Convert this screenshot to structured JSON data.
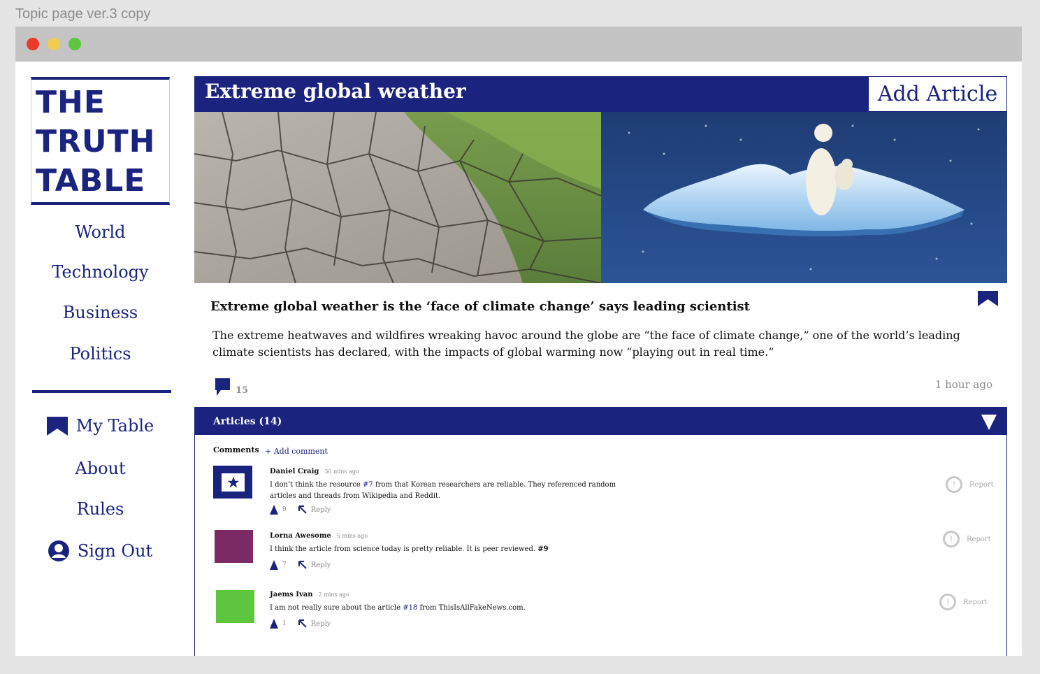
{
  "artboard_title": "Topic page ver.3 copy",
  "logo": {
    "line1": "THE",
    "line2": "TRUTH",
    "line3": "TABLE"
  },
  "nav": {
    "world": "World",
    "technology": "Technology",
    "business": "Business",
    "politics": "Politics",
    "my_table": "My Table",
    "about": "About",
    "rules": "Rules",
    "sign_out": "Sign Out"
  },
  "topic": {
    "title": "Extreme global weather",
    "add_article_label": "Add Article"
  },
  "article": {
    "headline": "Extreme global weather is the ‘face of climate change’ says leading scientist",
    "summary": "The extreme heatwaves and wildfires wreaking havoc around the globe are “the face of climate change,” one of the world’s leading climate scientists has declared, with the impacts of global warming now “playing out in real time.”",
    "comment_count": "15",
    "time_ago": "1 hour ago"
  },
  "articles_panel": {
    "label": "Articles (14)",
    "comments_label": "Comments",
    "add_comment_label": "+ Add comment",
    "reply_label": "Reply",
    "report_label": "Report"
  },
  "comments": [
    {
      "name": "Daniel Craig",
      "time": "30 mins ago",
      "text_before": "I don’t think the resource ",
      "ref": "#7",
      "text_after": " from that Korean researchers are reliable. They referenced random articles and threads from Wikipedia and Reddit.",
      "votes": "9",
      "avatar_color": "#1a237e"
    },
    {
      "name": "Lorna Awesome",
      "time": "5 mins ago",
      "text_before": "I think the article from science today is pretty reliable. It is peer reviewed. ",
      "ref": "#9",
      "text_after": "",
      "votes": "7",
      "avatar_color": "#7b2a63"
    },
    {
      "name": "Jaems Ivan",
      "time": "2 mins ago",
      "text_before": "I am not really sure about the article ",
      "ref": "#18",
      "text_after": " from ThisIsAllFakeNews.com.",
      "votes": "1",
      "avatar_color": "#5ec53e"
    }
  ],
  "colors": {
    "brand": "#1a237e",
    "muted": "#8a8a8a"
  },
  "icons": [
    "bookmark-icon",
    "user-circle-icon",
    "comment-icon",
    "chevron-down-icon",
    "upvote-icon",
    "reply-arrow-icon",
    "report-icon",
    "star-icon"
  ]
}
